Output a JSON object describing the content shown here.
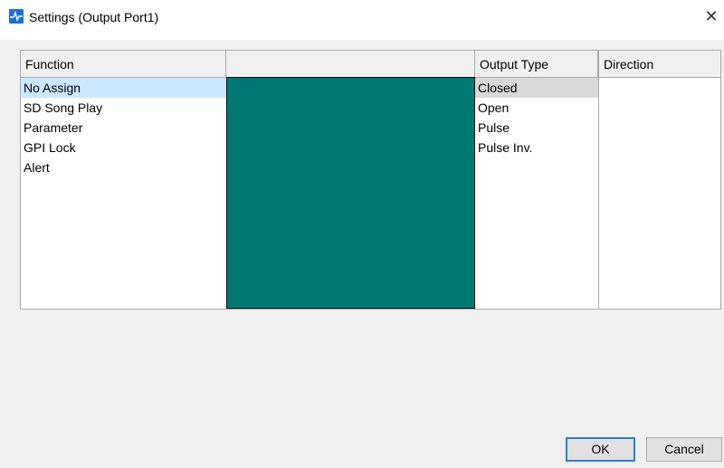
{
  "window": {
    "title": "Settings (Output Port1)",
    "close_glyph": "✕"
  },
  "table": {
    "columns": {
      "function": {
        "header": "Function",
        "items": [
          "No Assign",
          "SD Song Play",
          "Parameter",
          "GPI Lock",
          "Alert"
        ],
        "selected": "No Assign"
      },
      "detail": {
        "header": "",
        "pane_color": "#007873"
      },
      "output_type": {
        "header": "Output Type",
        "items": [
          "Closed",
          "Open",
          "Pulse",
          "Pulse Inv."
        ],
        "selected": "Closed"
      },
      "direction": {
        "header": "Direction",
        "items": []
      }
    }
  },
  "buttons": {
    "ok": "OK",
    "cancel": "Cancel"
  },
  "colors": {
    "selection_blue": "#cce8ff",
    "selection_gray": "#d9d9d9",
    "teal": "#007873",
    "ok_border": "#2a7fd4"
  }
}
